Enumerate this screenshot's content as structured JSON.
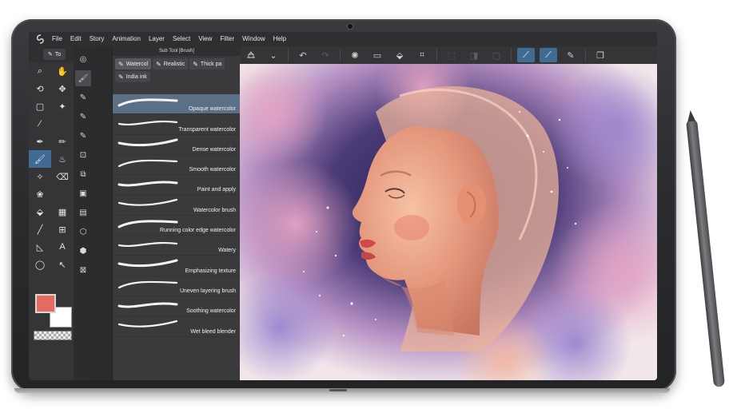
{
  "menubar": {
    "items": [
      "File",
      "Edit",
      "Story",
      "Animation",
      "Layer",
      "Select",
      "View",
      "Filter",
      "Window",
      "Help"
    ]
  },
  "tools": {
    "tab_label": "To"
  },
  "subtool_panel": {
    "title": "Sub Tool [Brush]",
    "tabs": [
      {
        "label": "Watercol",
        "icon": "brush-icon",
        "active": true
      },
      {
        "label": "Realistic",
        "icon": "brush-icon",
        "active": false
      },
      {
        "label": "Thick pa",
        "icon": "brush-icon",
        "active": false
      },
      {
        "label": "India ink",
        "icon": "brush-icon",
        "active": false
      }
    ],
    "brushes": [
      {
        "name": "Opaque watercolor",
        "selected": true
      },
      {
        "name": "Transparent watercolor",
        "selected": false
      },
      {
        "name": "Dense watercolor",
        "selected": false
      },
      {
        "name": "Smooth watercolor",
        "selected": false
      },
      {
        "name": "Paint and apply",
        "selected": false
      },
      {
        "name": "Watercolor brush",
        "selected": false
      },
      {
        "name": "Running color edge watercolor",
        "selected": false
      },
      {
        "name": "Watery",
        "selected": false
      },
      {
        "name": "Emphasizing texture",
        "selected": false
      },
      {
        "name": "Uneven layering brush",
        "selected": false
      },
      {
        "name": "Soothing watercolor",
        "selected": false
      },
      {
        "name": "Wet bleed blender",
        "selected": false
      }
    ]
  },
  "colors": {
    "main_color": "#e36b62",
    "sub_color": "#ffffff",
    "accent": "#3f6b94"
  }
}
